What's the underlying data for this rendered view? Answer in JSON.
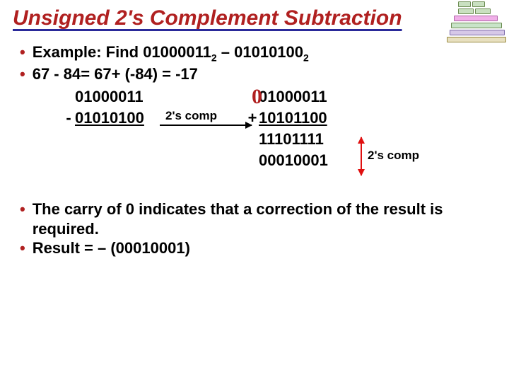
{
  "title": "Unsigned 2's Complement Subtraction",
  "example": {
    "label_prefix": "Example: Find ",
    "minuend_bits": "01000011",
    "sub_a": "2",
    "dash": " – ",
    "subtrahend_bits": "01010100",
    "sub_b": "2"
  },
  "decimal_line": "67 - 84= 67+ (-84) = -17",
  "carry_symbol": "0",
  "calc_left_top": "01000011",
  "calc_left_minus": "-",
  "calc_left_bottom": "01010100",
  "twos_middle_label": "2's comp",
  "calc_right_top": "01000011",
  "calc_right_plus": "+",
  "calc_right_add": "10101100",
  "calc_right_sum": "11101111",
  "calc_right_result": "00010001",
  "twos_right_label": "2's comp",
  "bullet3_pre": "The ",
  "bullet3_carry": "carry",
  "bullet3_mid1": " of ",
  "bullet3_zero": "0",
  "bullet3_mid2": " indicates that a ",
  "bullet3_correction": "correction",
  "bullet3_tail": " of the result is required.",
  "bullet4": "Result = – (00010001)"
}
